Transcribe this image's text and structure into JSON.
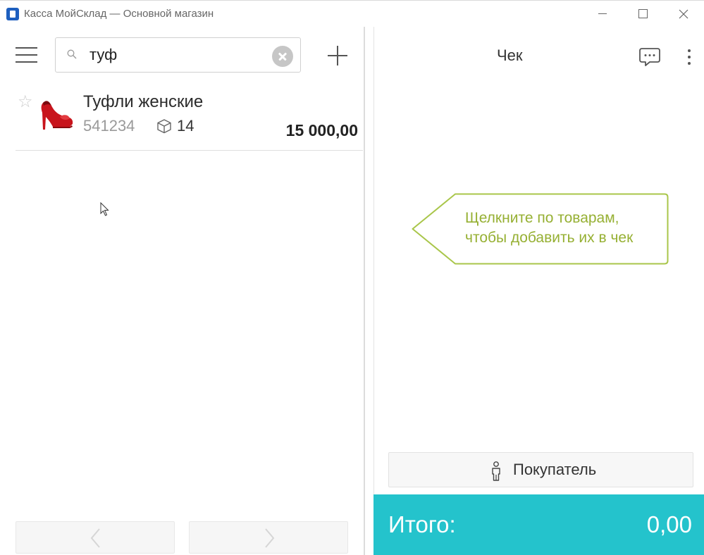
{
  "window": {
    "title": "Касса МойСклад — Основной магазин"
  },
  "search": {
    "value": "туф",
    "placeholder": ""
  },
  "products": [
    {
      "name": "Туфли женские",
      "code": "541234",
      "stock": "14",
      "price": "15 000,00",
      "favorite": false,
      "icon": "red-high-heel-shoe"
    }
  ],
  "receipt": {
    "title": "Чек",
    "hint": [
      "Щелкните по товарам,",
      "чтобы добавить их в чек"
    ],
    "customer_label": "Покупатель",
    "total_label": "Итого:",
    "total_value": "0,00"
  },
  "colors": {
    "accent_total": "#24c3cc",
    "hint_text": "#96b033",
    "hint_border": "#a9c64a"
  }
}
